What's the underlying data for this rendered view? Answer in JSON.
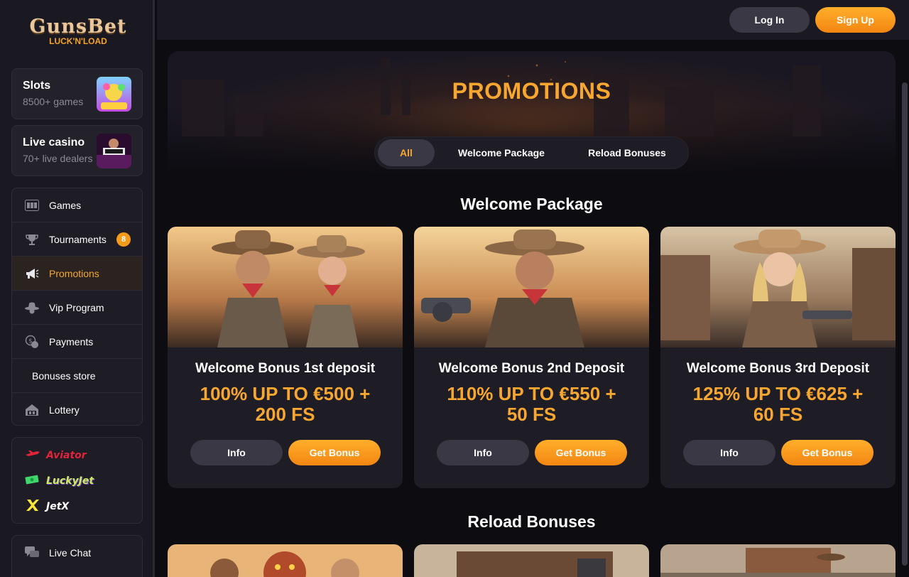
{
  "logo": {
    "main": "GunsBet",
    "sub": "LUCK'N'LOAD"
  },
  "categories": [
    {
      "title": "Slots",
      "sub": "8500+ games"
    },
    {
      "title": "Live casino",
      "sub": "70+ live dealers"
    }
  ],
  "nav": [
    {
      "label": "Games",
      "icon": "slot-machine-icon"
    },
    {
      "label": "Tournaments",
      "icon": "trophy-icon",
      "badge": "8"
    },
    {
      "label": "Promotions",
      "icon": "megaphone-icon",
      "active": true
    },
    {
      "label": "Vip Program",
      "icon": "cowboy-hat-icon"
    },
    {
      "label": "Payments",
      "icon": "coins-icon"
    },
    {
      "label": "Bonuses store"
    },
    {
      "label": "Lottery",
      "icon": "lottery-icon"
    }
  ],
  "quick_games": [
    "Aviator",
    "LuckyJet",
    "JetX"
  ],
  "chat": {
    "label": "Live Chat"
  },
  "header": {
    "login": "Log In",
    "signup": "Sign Up"
  },
  "hero": {
    "title": "PROMOTIONS"
  },
  "tabs": [
    "All",
    "Welcome Package",
    "Reload Bonuses"
  ],
  "sections": {
    "welcome": "Welcome Package",
    "reload": "Reload Bonuses"
  },
  "cards": [
    {
      "title": "Welcome Bonus 1st deposit",
      "offer_line1": "100% UP TO €500 +",
      "offer_line2": "200 FS",
      "info": "Info",
      "get": "Get Bonus"
    },
    {
      "title": "Welcome Bonus 2nd Deposit",
      "offer_line1": "110% UP TO €550 +",
      "offer_line2": "50 FS",
      "info": "Info",
      "get": "Get Bonus"
    },
    {
      "title": "Welcome Bonus 3rd Deposit",
      "offer_line1": "125% UP TO €625 +",
      "offer_line2": "60 FS",
      "info": "Info",
      "get": "Get Bonus"
    }
  ],
  "colors": {
    "accent": "#f7a630",
    "bg": "#0d0c11",
    "panel": "#1e1c24"
  }
}
